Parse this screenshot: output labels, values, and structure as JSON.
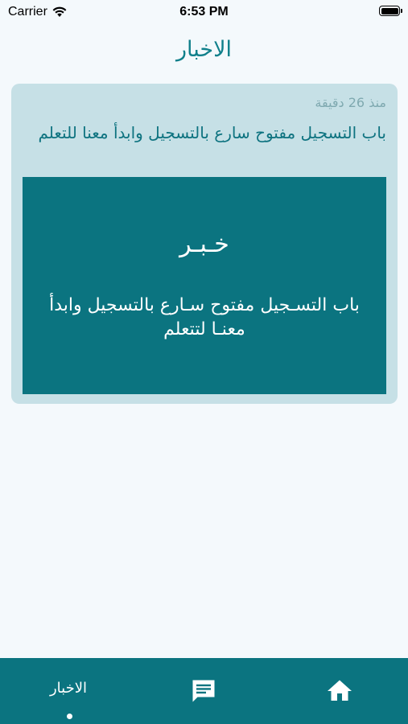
{
  "status_bar": {
    "carrier": "Carrier",
    "time": "6:53 PM"
  },
  "header": {
    "title": "الاخبار"
  },
  "news": [
    {
      "time_ago": "منذ 26 دقيقة",
      "headline": "باب التسجيل مفتوح سارع بالتسجيل وابدأ معنا للتعلم",
      "image_title": "خـبـر",
      "image_text": "باب التسـجيل مفتوح سـارع بالتسجيل وابدأ معنـا لتتعلم"
    }
  ],
  "tab_bar": {
    "news_label": "الاخبار",
    "active_tab": "news",
    "icons": [
      "home-icon",
      "message-icon"
    ]
  },
  "colors": {
    "primary": "#0b7480",
    "card_bg": "#c6e0e6",
    "page_bg": "#f4f9fc"
  }
}
